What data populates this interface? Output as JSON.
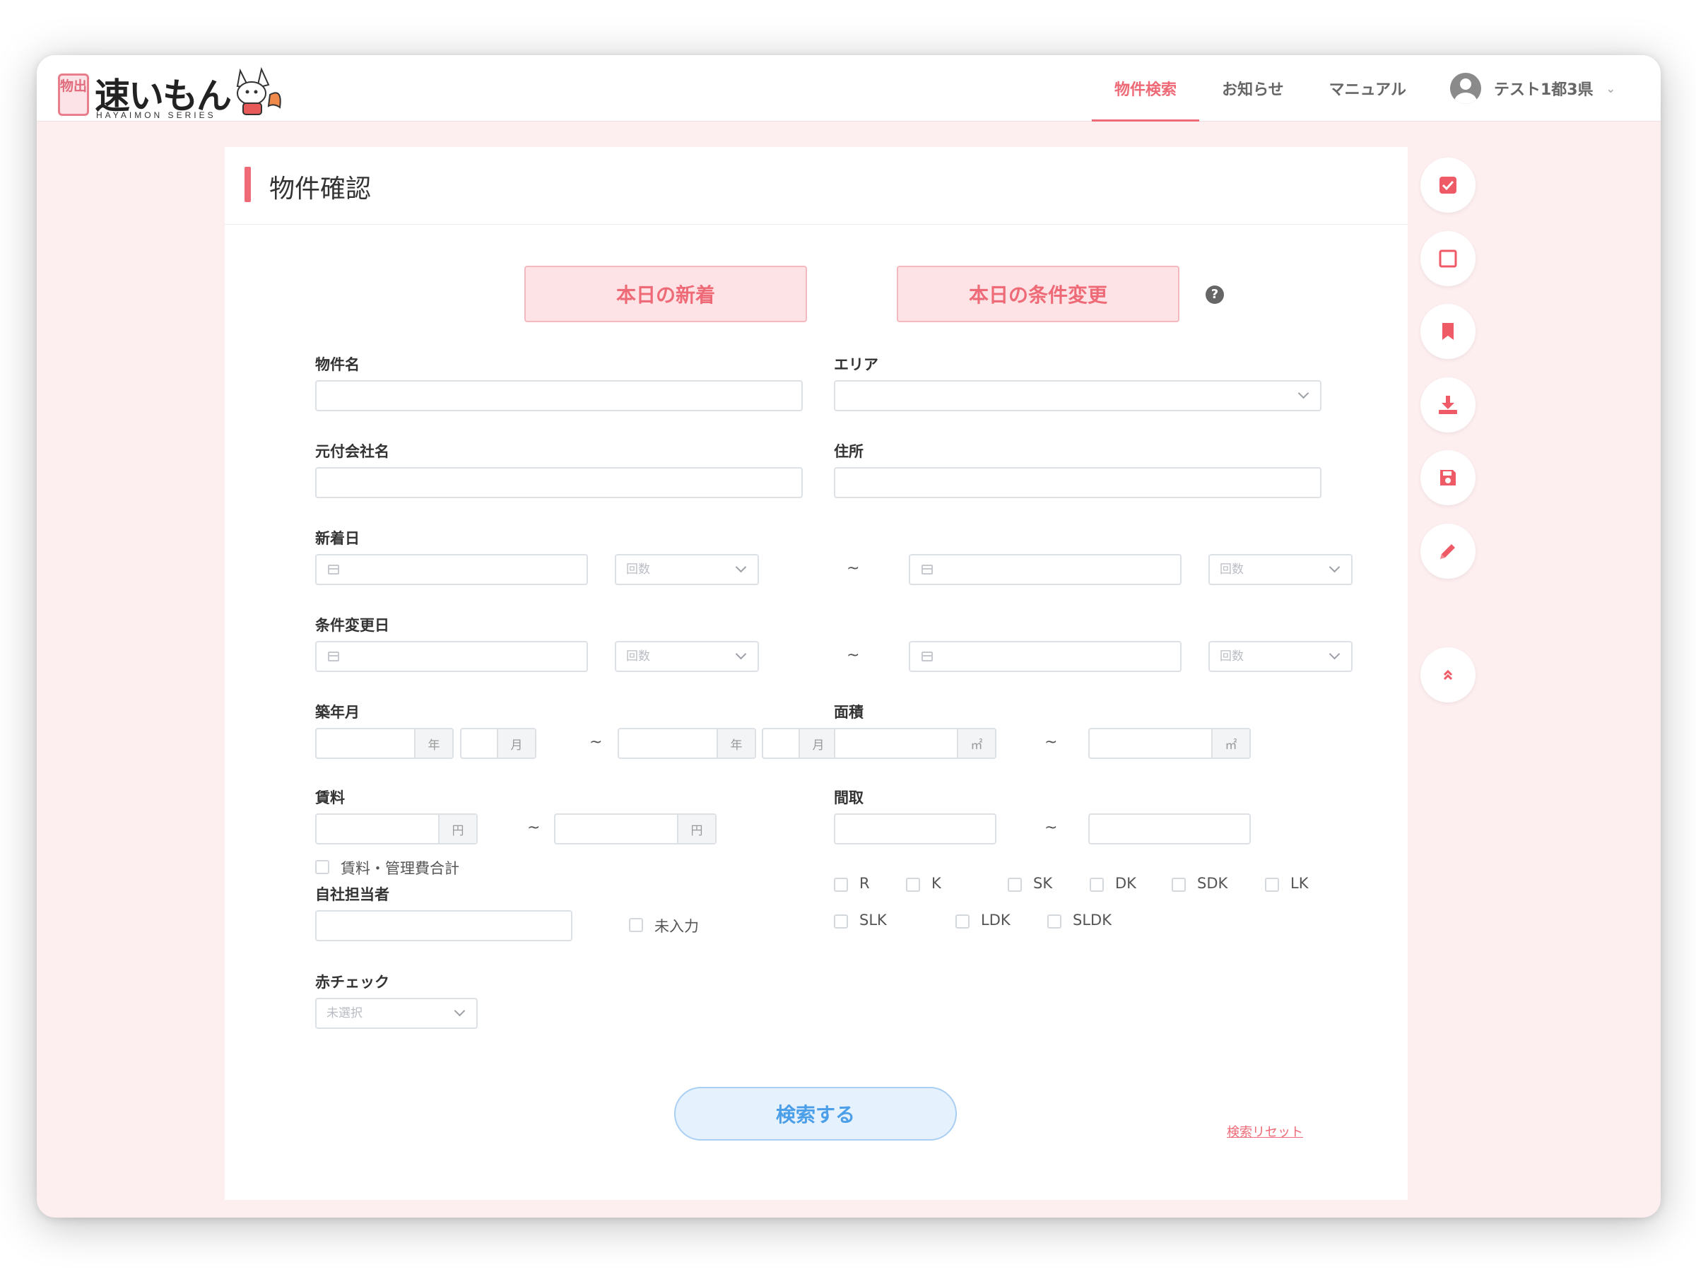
{
  "app": {
    "logo_stamp": "物出",
    "logo_text": "速いもん",
    "logo_sub": "HAYAIMON SERIES"
  },
  "nav": {
    "items": [
      {
        "label": "物件検索",
        "active": true
      },
      {
        "label": "お知らせ",
        "active": false
      },
      {
        "label": "マニュアル",
        "active": false
      }
    ],
    "user_name": "テスト1都3県"
  },
  "page": {
    "title": "物件確認",
    "today_new_label": "本日の新着",
    "today_changed_label": "本日の条件変更",
    "help_icon": "?"
  },
  "form": {
    "property_name_label": "物件名",
    "area_label": "エリア",
    "company_label": "元付会社名",
    "address_label": "住所",
    "new_date_label": "新着日",
    "change_date_label": "条件変更日",
    "count_placeholder": "回数",
    "tilde": "~",
    "built_label": "築年月",
    "year_unit": "年",
    "month_unit": "月",
    "area_size_label": "面積",
    "sqm_unit": "㎡",
    "rent_label": "賃料",
    "yen_unit": "円",
    "rent_total_label": "賃料・管理費合計",
    "layout_label": "間取",
    "layout_options_row1": [
      "R",
      "K",
      "SK",
      "DK",
      "SDK",
      "LK"
    ],
    "layout_options_row2": [
      "SLK",
      "LDK",
      "SLDK"
    ],
    "staff_label": "自社担当者",
    "unentered_label": "未入力",
    "red_check_label": "赤チェック",
    "red_check_value": "未選択",
    "search_button": "検索する",
    "reset_link": "検索リセット"
  },
  "sidebar_tools": [
    "check-square-icon",
    "square-icon",
    "bookmark-icon",
    "download-icon",
    "save-icon",
    "pencil-icon",
    "chevron-double-up-icon"
  ],
  "colors": {
    "accent": "#ee6a76",
    "background": "#fdeef0",
    "search_button_bg": "#e5f1fd",
    "search_button_text": "#4b9ee8"
  }
}
